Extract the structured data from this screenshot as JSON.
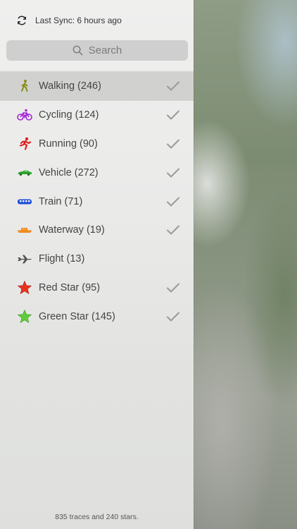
{
  "sync": {
    "text": "Last Sync: 6 hours ago",
    "icon": "sync-icon"
  },
  "search": {
    "placeholder": "Search",
    "icon": "search-icon"
  },
  "categories": [
    {
      "label": "Walking (246)",
      "icon": "walking-icon",
      "color": "#8a8d1a",
      "checked": true,
      "selected": true
    },
    {
      "label": "Cycling (124)",
      "icon": "bicycle-icon",
      "color": "#a326d6",
      "checked": true,
      "selected": false
    },
    {
      "label": "Running (90)",
      "icon": "running-icon",
      "color": "#e02020",
      "checked": true,
      "selected": false
    },
    {
      "label": "Vehicle (272)",
      "icon": "car-icon",
      "color": "#2aa52a",
      "checked": true,
      "selected": false
    },
    {
      "label": "Train (71)",
      "icon": "train-icon",
      "color": "#1f4fd8",
      "checked": true,
      "selected": false
    },
    {
      "label": "Waterway (19)",
      "icon": "boat-icon",
      "color": "#f08a1c",
      "checked": true,
      "selected": false
    },
    {
      "label": "Flight (13)",
      "icon": "airplane-icon",
      "color": "#555555",
      "checked": false,
      "selected": false
    },
    {
      "label": "Red Star (95)",
      "icon": "red-star-icon",
      "color": "#e8321e",
      "checked": true,
      "selected": false
    },
    {
      "label": "Green Star (145)",
      "icon": "green-star-icon",
      "color": "#5fcc3a",
      "checked": true,
      "selected": false
    }
  ],
  "footer": {
    "text": "835 traces and 240 stars."
  },
  "colors": {
    "check": "#9a9b99",
    "panel": "#ebebea"
  }
}
